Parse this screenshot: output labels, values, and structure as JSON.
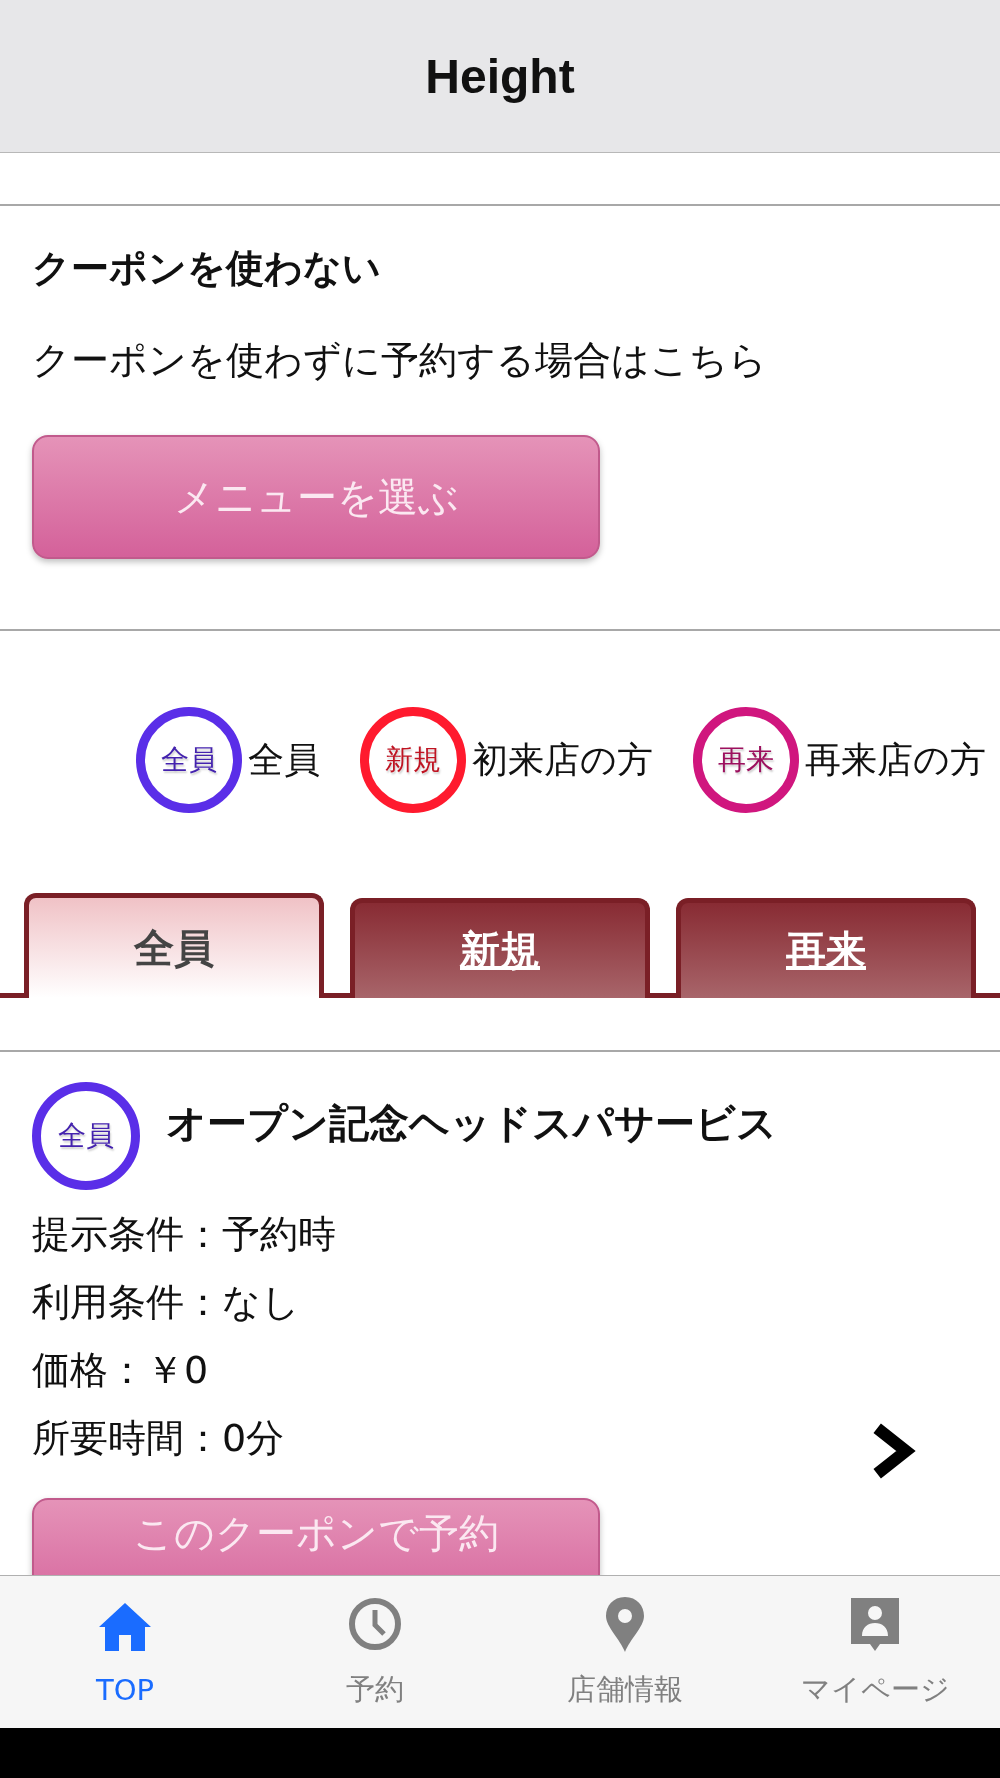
{
  "header": {
    "title": "Height"
  },
  "no_coupon": {
    "title": "クーポンを使わない",
    "description": "クーポンを使わずに予約する場合はこちら",
    "button": "メニューを選ぶ"
  },
  "legend": [
    {
      "badge": "全員",
      "label": "全員",
      "color": "#5a2ee8"
    },
    {
      "badge": "新規",
      "label": "初来店の方",
      "color": "#ff1a2e"
    },
    {
      "badge": "再来",
      "label": "再来店の方",
      "color": "#d0167e"
    }
  ],
  "tabs": [
    {
      "label": "全員",
      "selected": true
    },
    {
      "label": "新規",
      "selected": false
    },
    {
      "label": "再来",
      "selected": false
    }
  ],
  "coupon": {
    "badge": "全員",
    "color": "#5a2ee8",
    "title": "オープン記念ヘッドスパサービス",
    "details": [
      "提示条件：予約時",
      "利用条件：なし",
      "価格：￥0",
      "所要時間：0分"
    ],
    "button": "このクーポンで予約"
  },
  "tab_bar": [
    {
      "kind": "home",
      "label": "TOP",
      "selected": true
    },
    {
      "kind": "clock",
      "label": "予約",
      "selected": false
    },
    {
      "kind": "pin",
      "label": "店舗情報",
      "selected": false
    },
    {
      "kind": "person",
      "label": "マイページ",
      "selected": false
    }
  ]
}
